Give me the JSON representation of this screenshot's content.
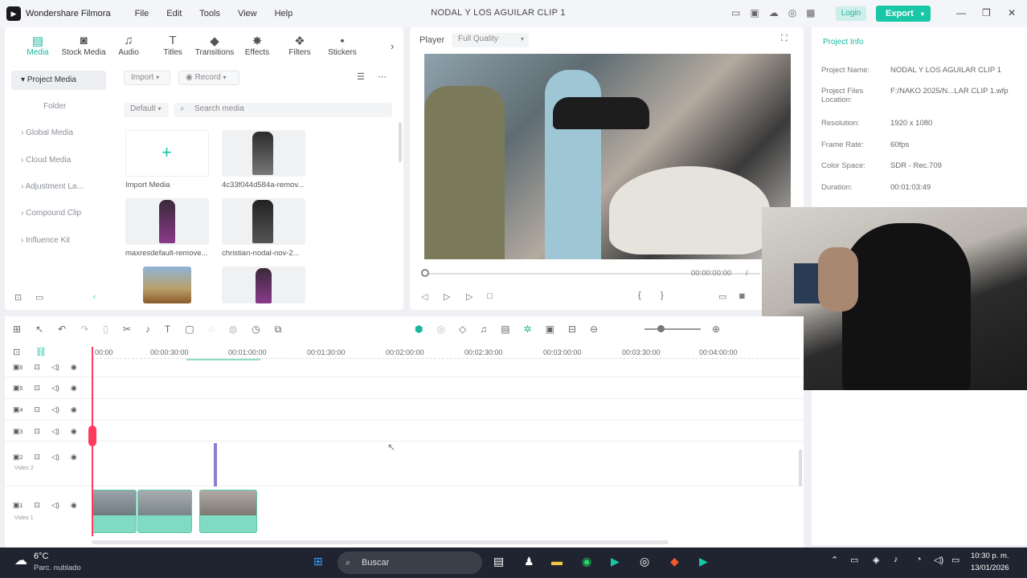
{
  "app": {
    "name": "Wondershare Filmora",
    "menu": [
      "File",
      "Edit",
      "Tools",
      "View",
      "Help"
    ],
    "window_title": "NODAL Y LOS AGUILAR CLIP 1",
    "login": "Login",
    "export": "Export"
  },
  "toolbar": [
    {
      "label": "Media",
      "icon": "media-icon",
      "active": true
    },
    {
      "label": "Stock Media",
      "icon": "stock-media-icon",
      "active": false
    },
    {
      "label": "Audio",
      "icon": "music-note-icon",
      "active": false
    },
    {
      "label": "Titles",
      "icon": "text-t-icon",
      "active": false
    },
    {
      "label": "Transitions",
      "icon": "transition-icon",
      "active": false
    },
    {
      "label": "Effects",
      "icon": "effects-icon",
      "active": false
    },
    {
      "label": "Filters",
      "icon": "filters-icon",
      "active": false
    },
    {
      "label": "Stickers",
      "icon": "stickers-icon",
      "active": false
    }
  ],
  "sidebar": {
    "items": [
      {
        "label": "Project Media",
        "selected": true
      },
      {
        "label": "Folder",
        "selected": false
      },
      {
        "label": "Global Media",
        "selected": false
      },
      {
        "label": "Cloud Media",
        "selected": false
      },
      {
        "label": "Adjustment La...",
        "selected": false
      },
      {
        "label": "Compound Clip",
        "selected": false
      },
      {
        "label": "Influence Kit",
        "selected": false
      }
    ]
  },
  "library": {
    "import": "Import",
    "record": "Record",
    "sort": "Default",
    "search_placeholder": "Search media",
    "items": [
      {
        "label": "Import Media"
      },
      {
        "label": "4c33f044d584a-remov..."
      },
      {
        "label": "maxresdefault-remove..."
      },
      {
        "label": "christian-nodal-nov-2..."
      },
      {
        "label": ""
      },
      {
        "label": ""
      }
    ]
  },
  "player": {
    "label": "Player",
    "quality": "Full Quality",
    "timecode": "00:00:00:00",
    "slash": "/"
  },
  "info": {
    "tab": "Project Info",
    "rows": [
      {
        "key": "Project Name:",
        "value": "NODAL Y LOS AGUILAR CLIP 1"
      },
      {
        "key": "Project Files Location:",
        "value": "F:/NAKO 2025/N...LAR CLIP 1.wfp"
      },
      {
        "key": "Resolution:",
        "value": "1920 x 1080"
      },
      {
        "key": "Frame Rate:",
        "value": "60fps"
      },
      {
        "key": "Color Space:",
        "value": "SDR - Rec.709"
      },
      {
        "key": "Duration:",
        "value": "00:01:03:49"
      }
    ]
  },
  "timeline": {
    "ticks": [
      "00:00",
      "00:00:30:00",
      "00:01:00:00",
      "00:01:30:00",
      "00:02:00:00",
      "00:02:30:00",
      "00:03:00:00",
      "00:03:30:00",
      "00:04:00:00"
    ],
    "tracks": [
      {
        "num": "6",
        "label": ""
      },
      {
        "num": "5",
        "label": ""
      },
      {
        "num": "4",
        "label": ""
      },
      {
        "num": "3",
        "label": ""
      },
      {
        "num": "2",
        "label": "Video 2"
      },
      {
        "num": "1",
        "label": "Video 1"
      }
    ]
  },
  "taskbar": {
    "weather_temp": "6°C",
    "weather_desc": "Parc. nublado",
    "search": "Buscar",
    "time": "10:30 p. m.",
    "date": "13/01/2026"
  },
  "colors": {
    "accent": "#19c7a6",
    "playhead": "#ff3b5c",
    "clip": "#7fdcc2"
  }
}
